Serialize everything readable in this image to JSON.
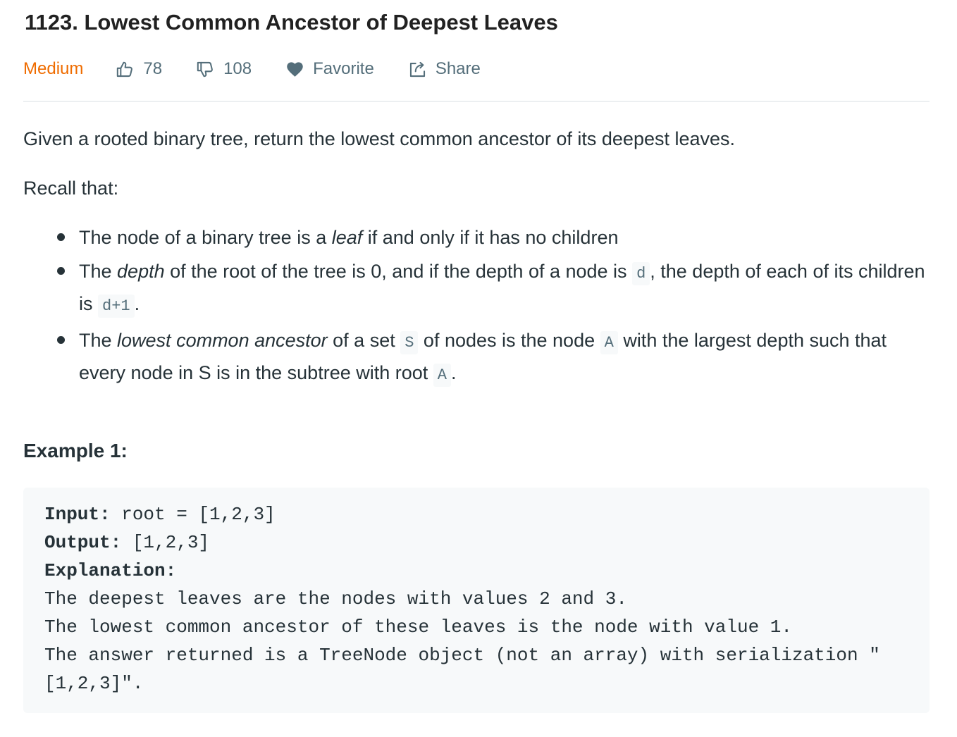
{
  "problem": {
    "title": "1123. Lowest Common Ancestor of Deepest Leaves",
    "difficulty": "Medium",
    "likes": "78",
    "dislikes": "108",
    "favorite_label": "Favorite",
    "share_label": "Share"
  },
  "colors": {
    "difficulty": "#ef6c00",
    "meta_text": "#546e7a",
    "body_text": "#263238",
    "code_background": "#f7f9fa"
  },
  "description": {
    "intro": "Given a rooted binary tree, return the lowest common ancestor of its deepest leaves.",
    "recall": "Recall that:",
    "rules": {
      "leaf": {
        "pre": "The node of a binary tree is a ",
        "em": "leaf",
        "post": " if and only if it has no children"
      },
      "depth": {
        "pre": "The ",
        "em": "depth",
        "mid": " of the root of the tree is 0, and if the depth of a node is ",
        "code1": "d",
        "mid2": ", the depth of each of its children is ",
        "code2": "d+1",
        "post": "."
      },
      "lca": {
        "pre": "The ",
        "em": "lowest common ancestor",
        "mid": " of a set ",
        "code1": "S",
        "mid2": " of nodes is the node ",
        "code2": "A",
        "mid3": " with the largest depth such that every node in S is in the subtree with root ",
        "code3": "A",
        "post": "."
      }
    }
  },
  "example": {
    "heading": "Example 1:",
    "input_label": "Input:",
    "input_value": " root = [1,2,3]",
    "output_label": "Output:",
    "output_value": " [1,2,3]",
    "explanation_label": "Explanation:",
    "explanation_lines": [
      "The deepest leaves are the nodes with values 2 and 3.",
      "The lowest common ancestor of these leaves is the node with value 1.",
      "The answer returned is a TreeNode object (not an array) with serialization \"[1,2,3]\"."
    ]
  }
}
